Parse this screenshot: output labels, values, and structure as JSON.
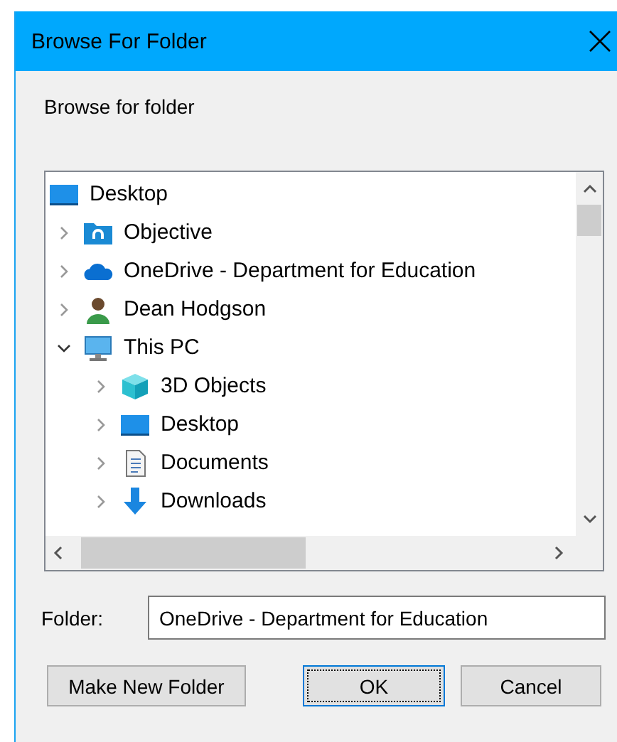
{
  "window": {
    "title": "Browse For Folder"
  },
  "prompt": "Browse for folder",
  "tree": {
    "root": {
      "label": "Desktop",
      "kind": "desktop"
    },
    "items": [
      {
        "label": "Objective",
        "kind": "folder-link",
        "expanded": false
      },
      {
        "label": "OneDrive - Department for Education",
        "kind": "cloud",
        "expanded": false
      },
      {
        "label": "Dean Hodgson",
        "kind": "user",
        "expanded": false
      },
      {
        "label": "This PC",
        "kind": "computer",
        "expanded": true,
        "children": [
          {
            "label": "3D Objects",
            "kind": "cube",
            "expanded": false
          },
          {
            "label": "Desktop",
            "kind": "desktop",
            "expanded": false
          },
          {
            "label": "Documents",
            "kind": "documents",
            "expanded": false
          },
          {
            "label": "Downloads",
            "kind": "download",
            "expanded": false
          }
        ]
      }
    ]
  },
  "folder": {
    "label": "Folder:",
    "value": "OneDrive - Department for Education"
  },
  "buttons": [
    {
      "label": "Make New Folder",
      "default": false
    },
    {
      "label": "OK",
      "default": true
    },
    {
      "label": "Cancel",
      "default": false
    }
  ]
}
